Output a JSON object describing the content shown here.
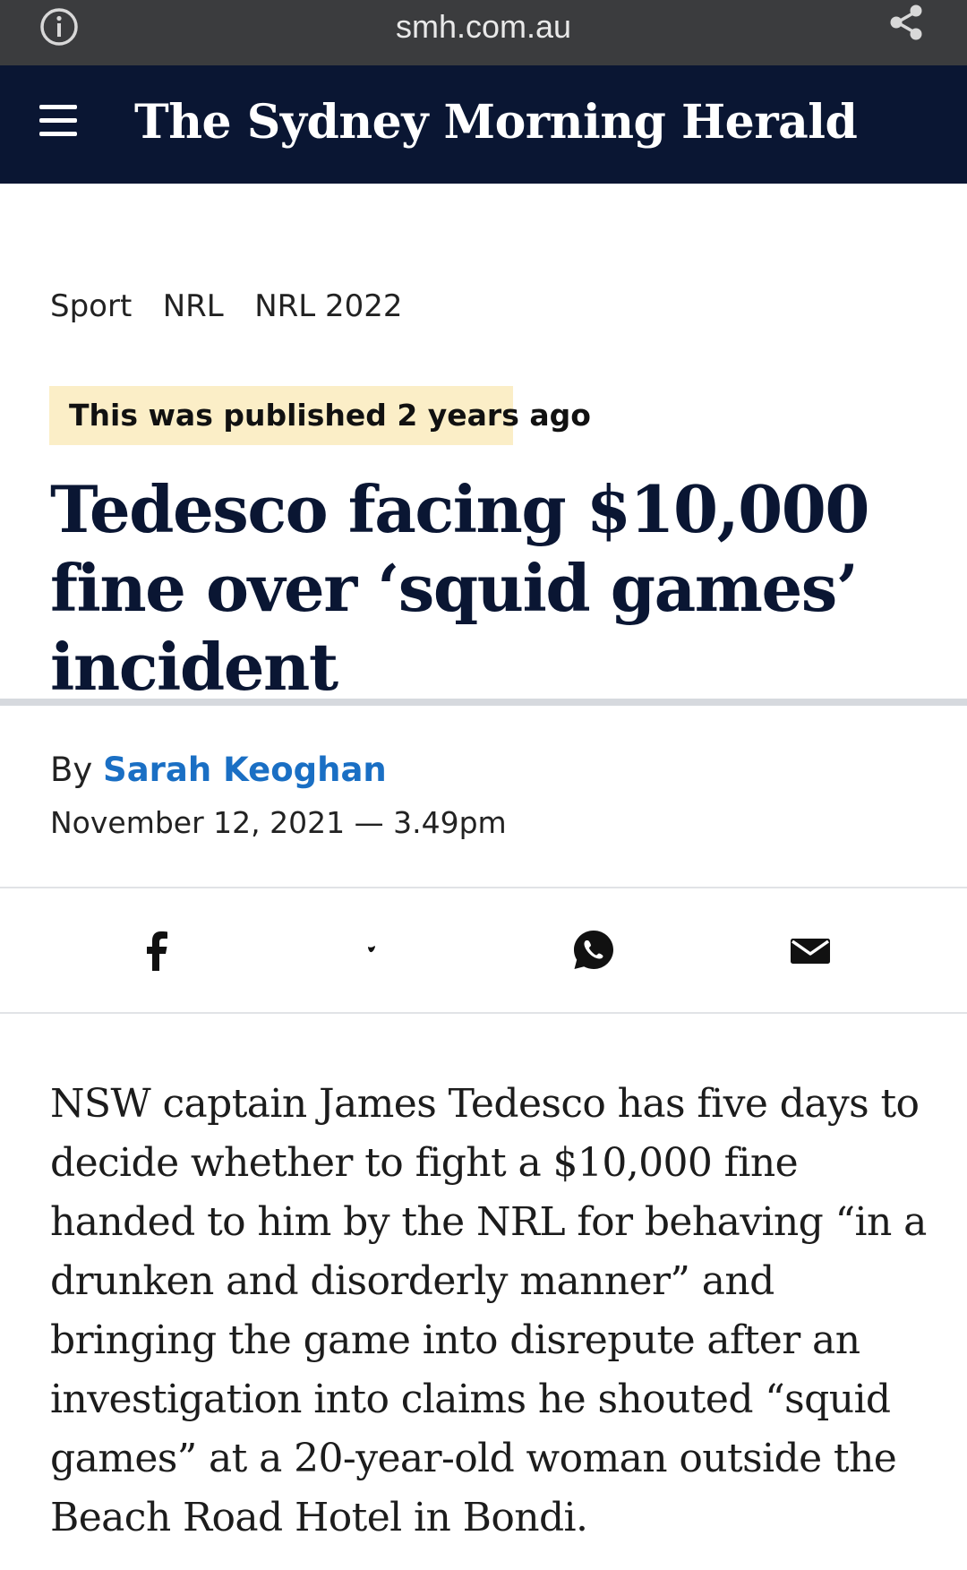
{
  "browser": {
    "url": "smh.com.au",
    "icons": [
      "info-icon",
      "share-icon"
    ]
  },
  "masthead": {
    "logo_text": "The Sydney Morning Herald",
    "menu_icon": "hamburger-menu-icon",
    "background": "#0a1633"
  },
  "breadcrumb": {
    "items": [
      "Sport",
      "NRL",
      "NRL 2022"
    ]
  },
  "notice": {
    "text": "This was published 2 years ago",
    "background": "#fbeec7"
  },
  "article": {
    "headline": "Tedesco facing $10,000 fine over ‘squid games’ incident",
    "by_prefix": "By",
    "author": "Sarah Keoghan",
    "date": "November 12, 2021 — 3.49pm",
    "body": "NSW captain James Tedesco has five days to decide whether to fight a $10,000 fine handed to him by the NRL for behaving “in a drunken and disorderly manner” and bringing the game into disrepute after an investigation into claims he shouted “squid games” at a 20-year-old woman outside the Beach Road Hotel in Bondi."
  },
  "share_buttons": [
    "facebook-icon",
    "twitter-icon",
    "whatsapp-icon",
    "email-icon"
  ],
  "colors": {
    "author_link": "#1a6fc4",
    "headline": "#0a1633",
    "url_bar": "#3b3c3e"
  }
}
